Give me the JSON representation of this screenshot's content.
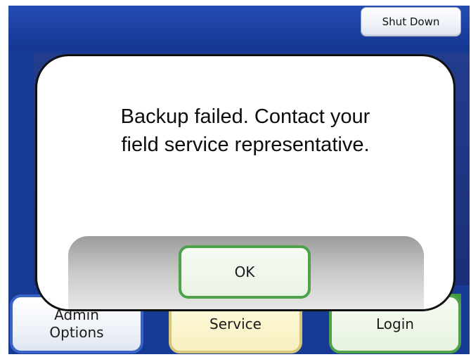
{
  "header": {
    "shutdown_label": "Shut Down"
  },
  "dialog": {
    "message_line1": "Backup failed. Contact your",
    "message_line2": "field service representative.",
    "ok_label": "OK"
  },
  "bottom_nav": {
    "admin_line1": "Admin",
    "admin_line2": "Options",
    "service_label": "Service",
    "login_label": "Login"
  },
  "colors": {
    "screen_blue": "#173a94",
    "admin_border": "#3a63c6",
    "service_border": "#d7c57a",
    "login_border": "#4ea34a"
  }
}
